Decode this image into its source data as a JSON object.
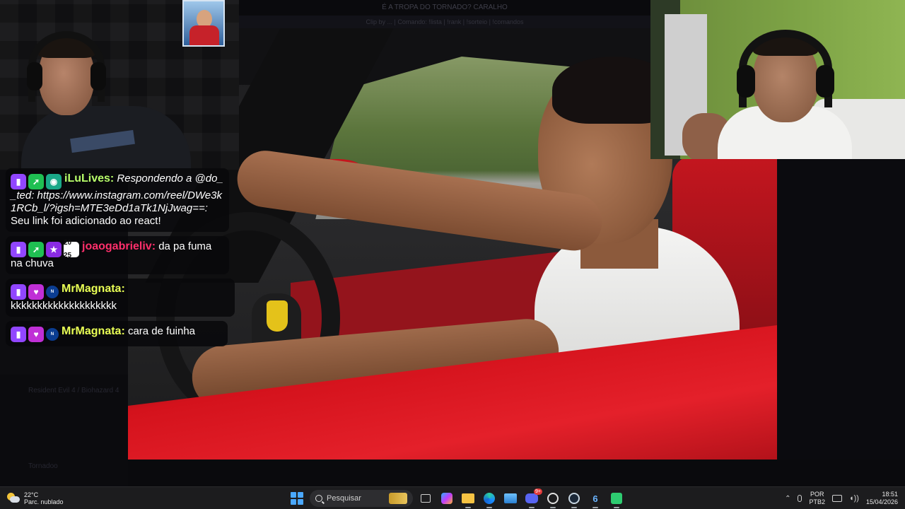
{
  "stream": {
    "title_bar": "É A TROPA DO TORNADO? CARALHO",
    "sub_bar": "Clip by ... | Comando: !lista | !rank | !sorteio | !comandos"
  },
  "chat": {
    "messages": [
      {
        "badges": [
          "twitch-icon",
          "rocket-icon",
          "robot-icon"
        ],
        "user": "iLuLives:",
        "user_color": "#b9ff6b",
        "reply": "Respondendo a @do__ted: https://www.instagram.com/reel/DWe3k1RCb_l/?igsh=MTE3eDd1aTk1NjJwag==:",
        "text": "Seu link foi adicionado ao react!"
      },
      {
        "badges": [
          "twitch-icon",
          "rocket-icon",
          "star-icon",
          "2025-badge"
        ],
        "badge_text": "20 25",
        "user": "joaogabrieliv:",
        "user_color": "#ff2f6b",
        "text": "da pa fuma na chuva"
      },
      {
        "badges": [
          "twitch-icon",
          "heart-icon",
          "nasa-icon"
        ],
        "user": "MrMagnata:",
        "user_color": "#e9ff55",
        "text": "kkkkkkkkkkkkkkkkkkkk"
      },
      {
        "badges": [
          "twitch-icon",
          "heart-icon",
          "nasa-icon"
        ],
        "user": "MrMagnata:",
        "user_color": "#e9ff55",
        "text": "cara de fuinha"
      }
    ]
  },
  "background_ui": {
    "left_lower": [
      "Resident Evil 4 / Biohazard 4",
      "Tornadoo"
    ]
  },
  "taskbar": {
    "weather_temp": "22°C",
    "weather_desc": "Parc. nublado",
    "search_placeholder": "Pesquisar",
    "discord_badge": "9+",
    "language_1": "POR",
    "language_2": "PTB2",
    "time": "18:51",
    "date": "15/04/2026",
    "icons": [
      "start-icon",
      "search-icon",
      "task-view-icon",
      "copilot-icon",
      "file-explorer-icon",
      "edge-icon",
      "photos-icon",
      "discord-icon",
      "obs-icon",
      "steam-icon",
      "six-icon",
      "green-app-icon"
    ]
  }
}
